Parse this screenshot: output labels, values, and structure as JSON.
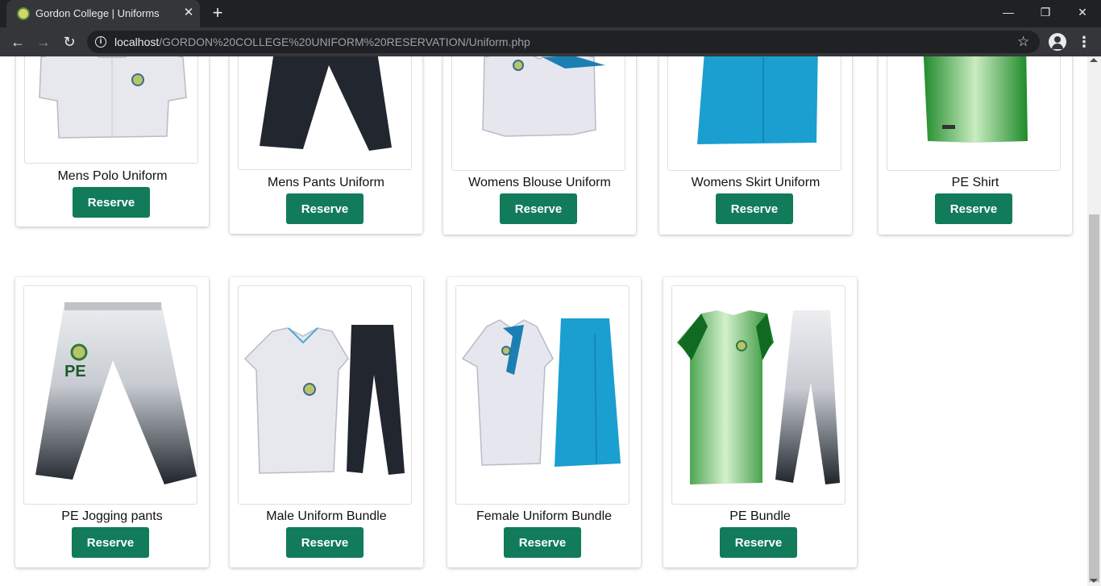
{
  "browser": {
    "tab_title": "Gordon College | Uniforms",
    "close_glyph": "✕",
    "newtab_glyph": "+",
    "url_host": "localhost",
    "url_path": "/GORDON%20COLLEGE%20UNIFORM%20RESERVATION/Uniform.php",
    "minimize_glyph": "—",
    "restore_glyph": "❐",
    "window_close_glyph": "✕",
    "back_glyph": "←",
    "forward_glyph": "→",
    "reload_glyph": "↻",
    "info_glyph": "i",
    "star_glyph": "☆",
    "menu_glyph": "⋮"
  },
  "products": [
    {
      "name": "Mens Polo Uniform",
      "button": "Reserve",
      "icon": "polo-shirt"
    },
    {
      "name": "Mens Pants Uniform",
      "button": "Reserve",
      "icon": "pants"
    },
    {
      "name": "Womens Blouse Uniform",
      "button": "Reserve",
      "icon": "blouse"
    },
    {
      "name": "Womens Skirt Uniform",
      "button": "Reserve",
      "icon": "skirt"
    },
    {
      "name": "PE Shirt",
      "button": "Reserve",
      "icon": "pe-shirt"
    },
    {
      "name": "PE Jogging pants",
      "button": "Reserve",
      "icon": "jogging-pants"
    },
    {
      "name": "Male Uniform Bundle",
      "button": "Reserve",
      "icon": "male-bundle"
    },
    {
      "name": "Female Uniform Bundle",
      "button": "Reserve",
      "icon": "female-bundle"
    },
    {
      "name": "PE Bundle",
      "button": "Reserve",
      "icon": "pe-bundle"
    }
  ],
  "colors": {
    "reserve_button": "#117b5a",
    "pe_green": "#2f9a2c",
    "skirt_blue": "#1a9fd0",
    "pants_dark": "#22262e"
  }
}
